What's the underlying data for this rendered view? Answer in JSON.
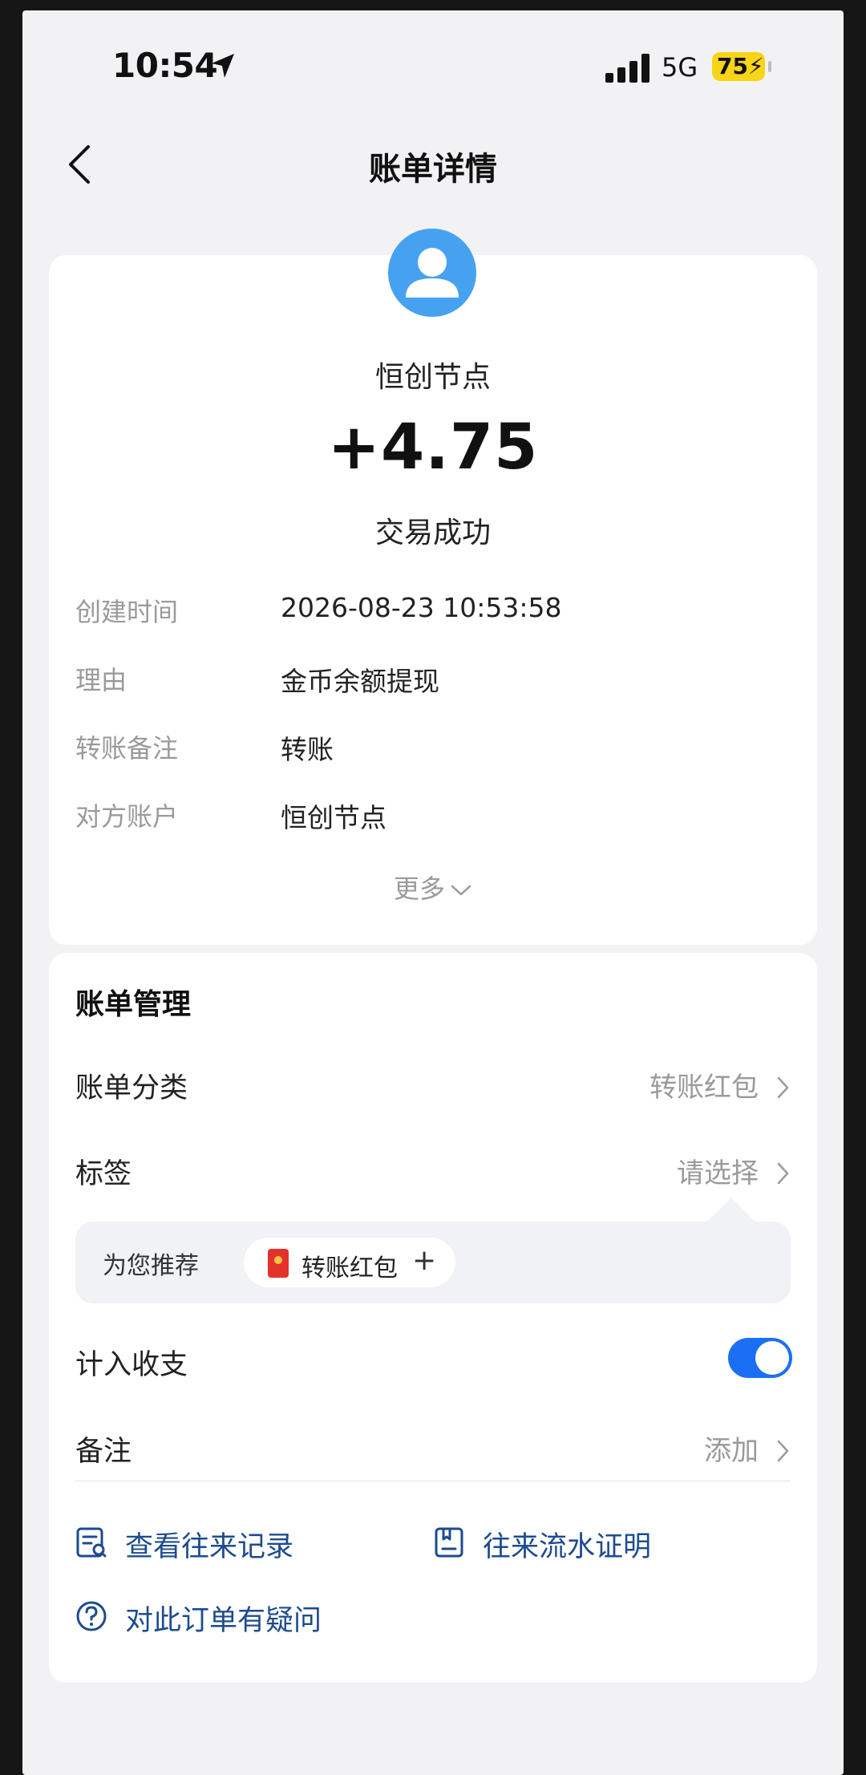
{
  "status_bar": {
    "time": "10:54",
    "network": "5G",
    "battery": "75",
    "battery_color": "#f7d417"
  },
  "nav": {
    "title": "账单详情",
    "back_icon": "chevron-left-icon"
  },
  "summary": {
    "avatar_icon": "user-avatar-icon",
    "avatar_color": "#46a2f0",
    "name": "恒创节点",
    "amount": "+4.75",
    "status": "交易成功"
  },
  "details": [
    {
      "label": "创建时间",
      "value": "2026-08-23 10:53:58"
    },
    {
      "label": "理由",
      "value": "金币余额提现"
    },
    {
      "label": "转账备注",
      "value": "转账"
    },
    {
      "label": "对方账户",
      "value": "恒创节点"
    }
  ],
  "more_label": "更多",
  "management": {
    "title": "账单管理",
    "category_label": "账单分类",
    "category_value": "转账红包",
    "tag_label": "标签",
    "tag_value": "请选择",
    "recommend_label": "为您推荐",
    "recommend_chip": "转账红包",
    "include_label": "计入收支",
    "include_on": true,
    "note_label": "备注",
    "note_value": "添加"
  },
  "links": {
    "history": "查看往来记录",
    "statement": "往来流水证明",
    "question": "对此订单有疑问"
  },
  "colors": {
    "accent": "#1a6ff4",
    "link": "#1d4b8f",
    "background": "#f2f2f4"
  }
}
